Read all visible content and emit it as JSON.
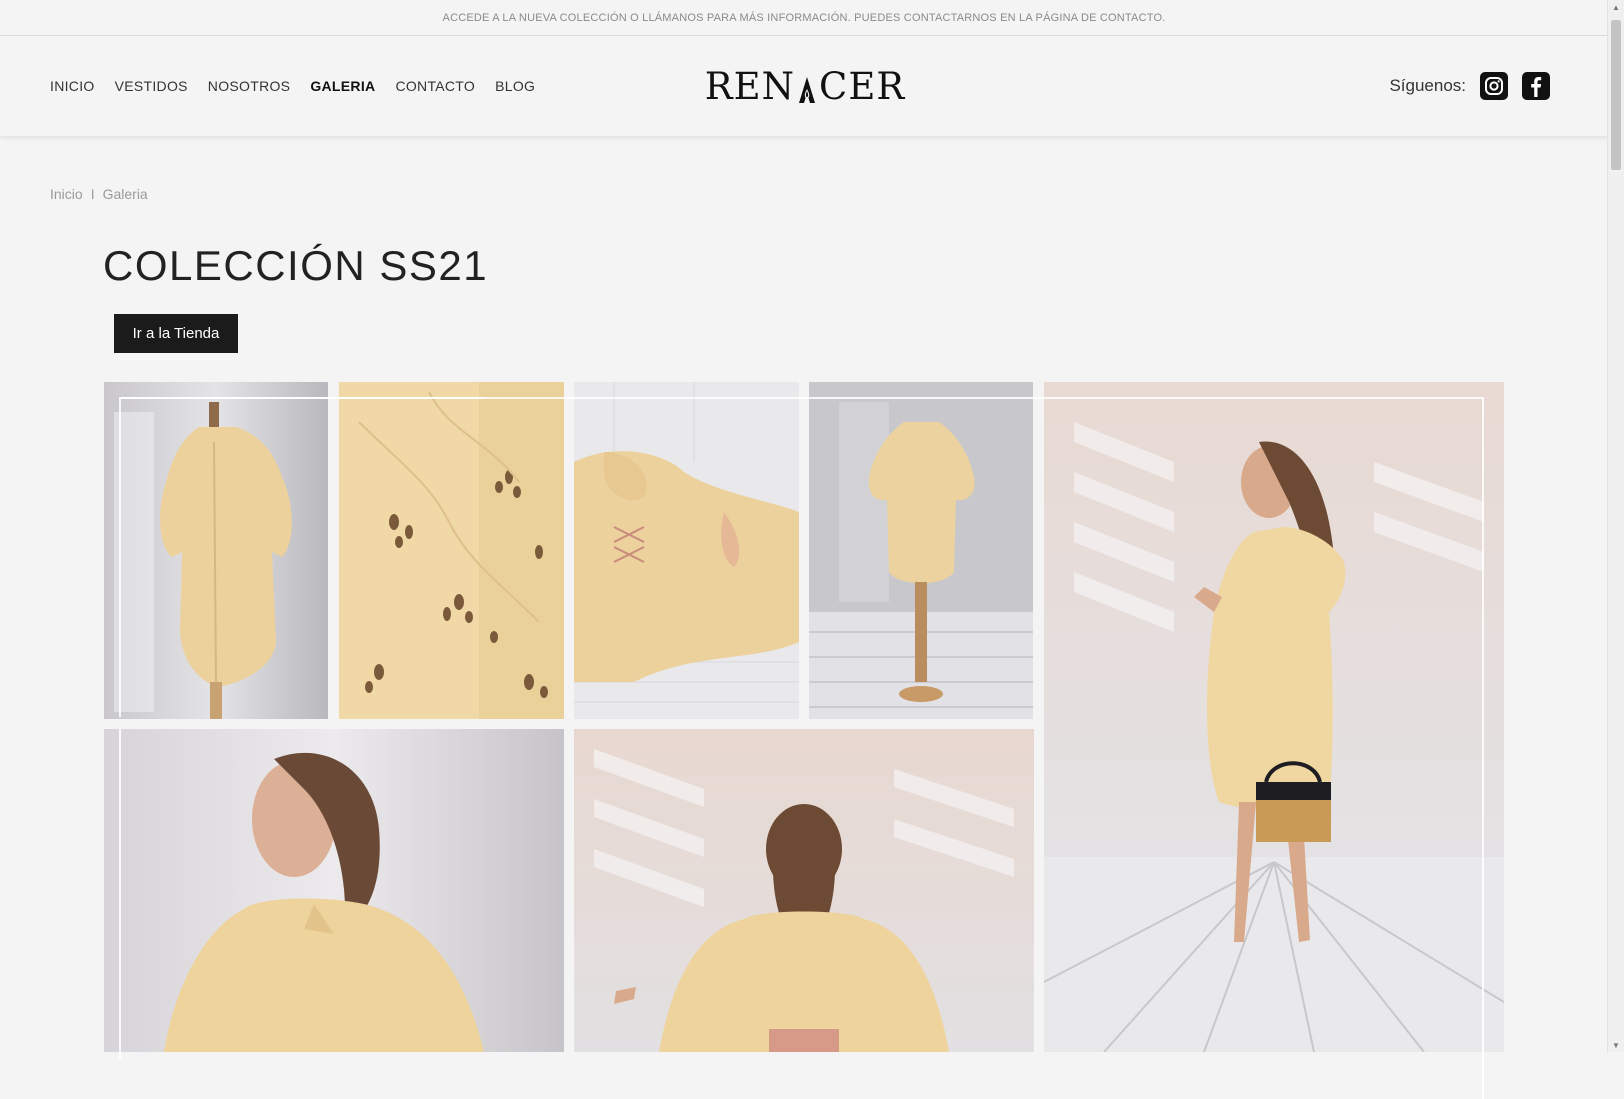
{
  "topbar": {
    "message": "ACCEDE A LA NUEVA COLECCIÓN O LLÁMANOS PARA MÁS INFORMACIÓN. PUEDES CONTACTARNOS EN LA PÁGINA DE CONTACTO."
  },
  "nav": {
    "items": [
      {
        "label": "INICIO"
      },
      {
        "label": "VESTIDOS"
      },
      {
        "label": "NOSOTROS"
      },
      {
        "label": "GALERIA",
        "active": true
      },
      {
        "label": "CONTACTO"
      },
      {
        "label": "BLOG"
      }
    ]
  },
  "logo": {
    "left": "REN",
    "right": "CER"
  },
  "social": {
    "label": "Síguenos:",
    "icons": [
      "instagram-icon",
      "facebook-icon"
    ]
  },
  "breadcrumb": {
    "home": "Inicio",
    "separator": "I",
    "current": "Galeria"
  },
  "page": {
    "title": "COLECCIÓN SS21",
    "shop_button": "Ir a la Tienda"
  },
  "gallery": {
    "images": [
      "dress-back-on-mannequin",
      "eyelet-fabric-closeup",
      "dress-lying-on-floor",
      "dress-on-mannequin-front",
      "model-side-view-with-bag",
      "model-profile-closeup",
      "model-back-view"
    ]
  },
  "colors": {
    "background": "#f4f4f4",
    "button": "#1b1b1b",
    "dress": "#f1d9a3"
  }
}
